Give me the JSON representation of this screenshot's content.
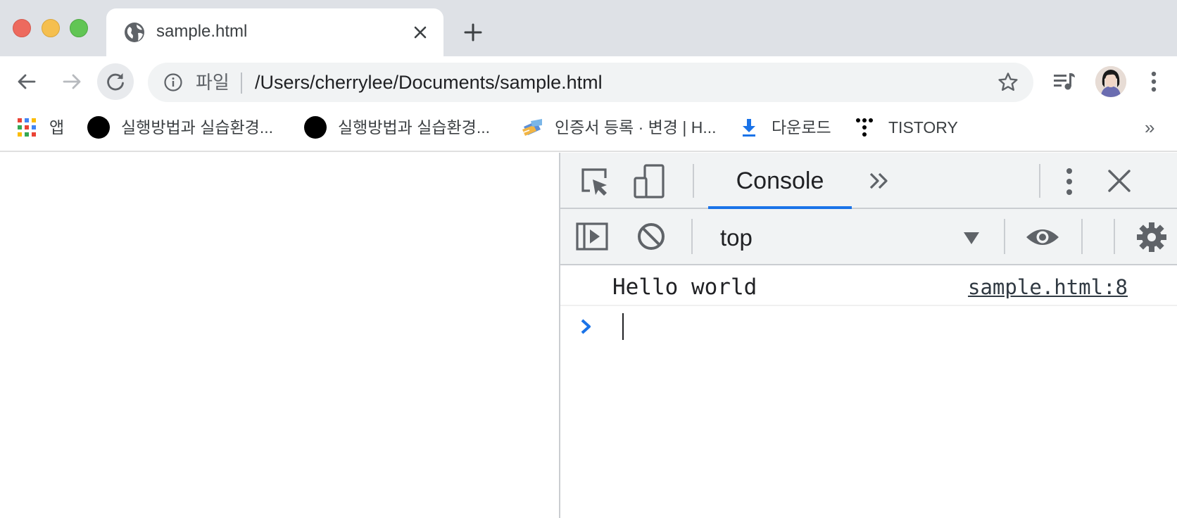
{
  "window": {
    "buttons": [
      "close",
      "minimize",
      "zoom"
    ]
  },
  "tab": {
    "title": "sample.html",
    "favicon": "globe-icon"
  },
  "toolbar": {
    "scheme_label": "파일",
    "url": "/Users/cherrylee/Documents/sample.html"
  },
  "bookmarks": {
    "items": [
      {
        "label": "앱",
        "icon": "apps-grid-icon"
      },
      {
        "label": "실행방법과 실습환경...",
        "icon": "black-dot-icon"
      },
      {
        "label": "실행방법과 실습환경...",
        "icon": "black-dot-icon"
      },
      {
        "label": "인증서 등록 · 변경 | H...",
        "icon": "certificate-icon"
      },
      {
        "label": "다운로드",
        "icon": "download-icon"
      },
      {
        "label": "TISTORY",
        "icon": "tistory-icon"
      }
    ],
    "overflow": "»"
  },
  "devtools": {
    "active_tab": "Console",
    "context": "top",
    "accent": "#1a73e8",
    "messages": [
      {
        "text": "Hello world",
        "source": "sample.html:8"
      }
    ]
  }
}
